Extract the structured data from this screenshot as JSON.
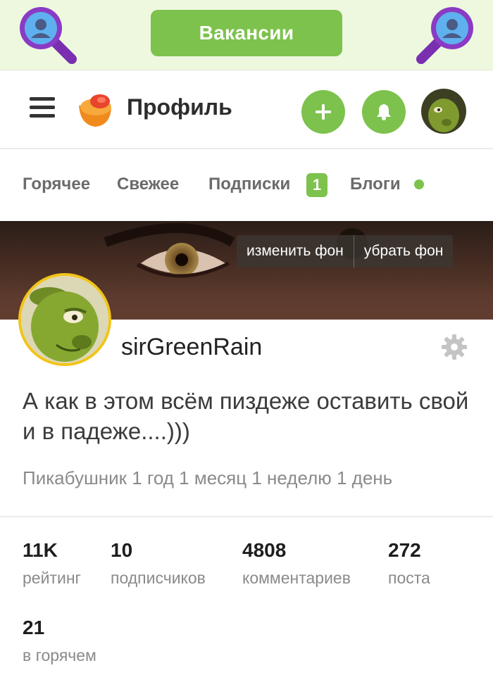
{
  "promo": {
    "button_label": "Вакансии"
  },
  "header": {
    "title": "Профиль"
  },
  "tabs": [
    {
      "label": "Горячее"
    },
    {
      "label": "Свежее"
    },
    {
      "label": "Подписки",
      "badge": "1"
    },
    {
      "label": "Блоги"
    }
  ],
  "cover": {
    "change_label": "изменить фон",
    "remove_label": "убрать фон"
  },
  "profile": {
    "username": "sirGreenRain",
    "bio": "А как в этом всём пиздеже оставить свой и в падеже....)))",
    "member_since": "Пикабушник 1 год 1 месяц 1 неделю 1 день"
  },
  "stats": [
    {
      "value": "11K",
      "label": "рейтинг"
    },
    {
      "value": "10",
      "label": "подписчиков"
    },
    {
      "value": "4808",
      "label": "комментариев"
    },
    {
      "value": "272",
      "label": "поста"
    },
    {
      "value": "21",
      "label": "в горячем"
    }
  ],
  "icons": {
    "magnifier_left": "magnifier-user-icon",
    "magnifier_right": "magnifier-user-icon",
    "menu": "hamburger-icon",
    "logo": "pikabu-logo",
    "add": "plus-icon",
    "notifications": "bell-icon",
    "settings": "gear-icon"
  },
  "colors": {
    "accent_green": "#7cc24c",
    "promo_bg": "#eef8df",
    "avatar_border": "#f2c418"
  }
}
